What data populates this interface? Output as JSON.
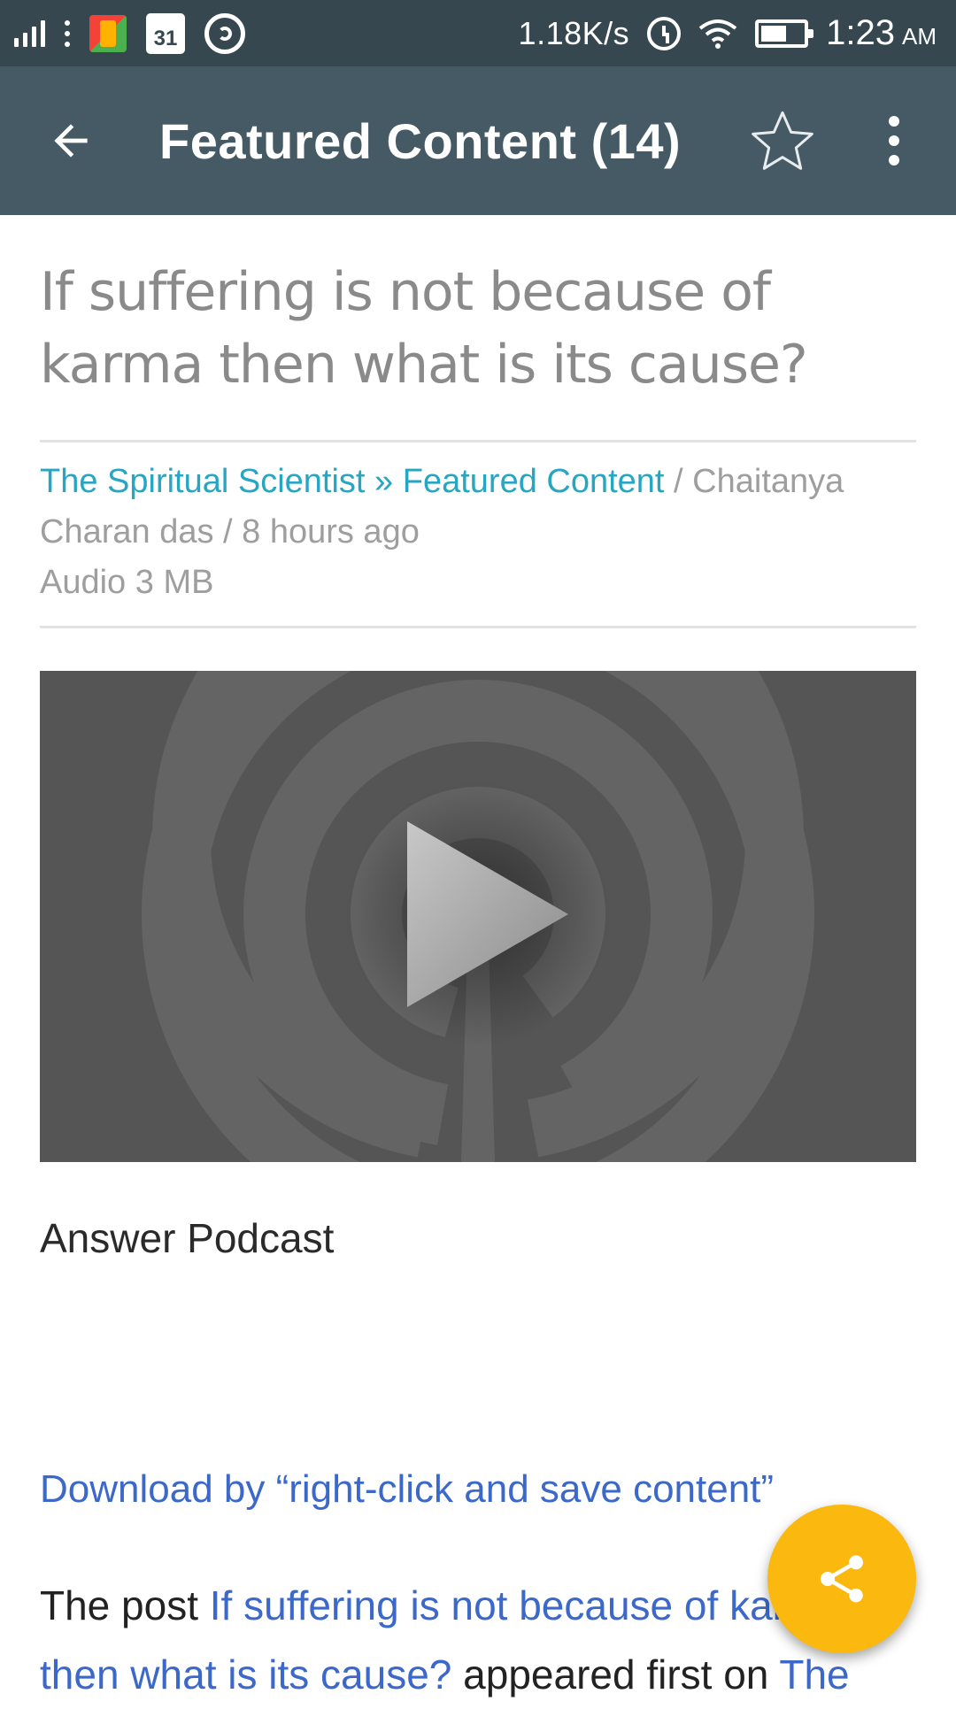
{
  "status_bar": {
    "network_speed": "1.18K/s",
    "time": "1:23",
    "ampm": "AM",
    "calendar_day": "31"
  },
  "app_bar": {
    "title": "Featured Content (14)"
  },
  "post": {
    "title": "If suffering is not because of karma then what is its cause?",
    "meta": {
      "site_link": "The Spiritual Scientist",
      "separator": " » ",
      "category_link": "Featured Content",
      "author_time": " / Chaitanya Charan das / 8 hours ago",
      "attachment": "Audio 3 MB"
    },
    "podcast_label": "Answer Podcast",
    "download_link": "Download by “right-click and save content”",
    "footer": {
      "prefix": "The post ",
      "post_link": "If suffering is not because of karma then what is its cause?",
      "middle": " appeared first on ",
      "site_link": "The"
    }
  },
  "colors": {
    "status_bar": "#37474f",
    "app_bar": "#455a64",
    "meta_link": "#26a6c2",
    "body_link": "#3b68c9",
    "fab": "#fbb80f"
  },
  "icons": {
    "back": "arrow-left-icon",
    "star": "star-outline-icon",
    "menu": "more-vert-icon",
    "share": "share-icon",
    "play": "play-icon"
  }
}
